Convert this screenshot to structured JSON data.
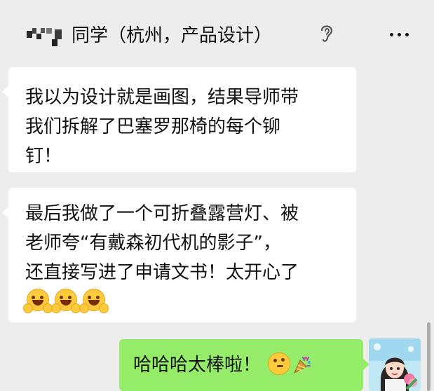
{
  "header": {
    "title": "同学（杭州，产品设计）",
    "icons": [
      "pixel-avatar",
      "ear-icon",
      "more-icon"
    ]
  },
  "messages": [
    {
      "side": "left",
      "lines": [
        "我以为设计就是画图，结果导师带",
        "我们拆解了巴塞罗那椅的每个铆",
        "钉！"
      ]
    },
    {
      "side": "left",
      "lines": [
        "最后我做了一个可折叠露营灯、被",
        "老师夸“有戴森初代机的影子”，",
        "还直接写进了申请文书！太开心了"
      ],
      "emojis": [
        "hugging-face",
        "hugging-face",
        "hugging-face"
      ]
    },
    {
      "side": "right",
      "text": "哈哈哈太棒啦！",
      "emojis": [
        "thinking-face",
        "party-popper"
      ]
    }
  ],
  "colors": {
    "background": "#ededed",
    "incoming_bubble": "#ffffff",
    "outgoing_bubble": "#95ec69",
    "text": "#111111"
  }
}
